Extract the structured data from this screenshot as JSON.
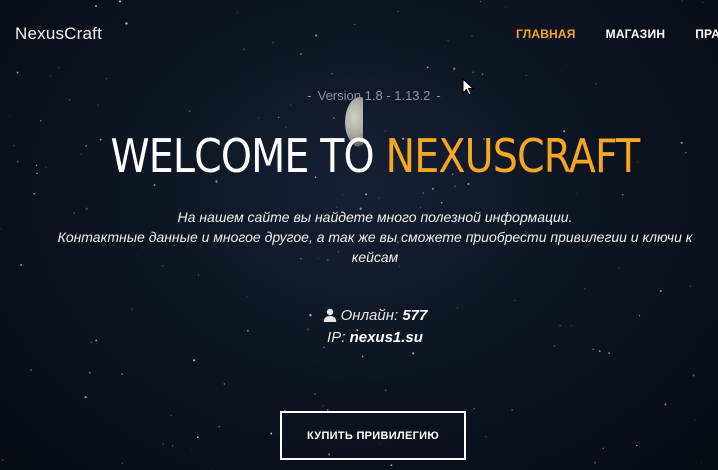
{
  "brand": "NexusCraft",
  "nav": {
    "items": [
      {
        "label": "ГЛАВНАЯ",
        "active": true
      },
      {
        "label": "МАГАЗИН",
        "active": false
      },
      {
        "label": "ПРАВИ",
        "active": false
      }
    ]
  },
  "hero": {
    "version_dash": "-",
    "version": "Version 1.8 - 1.13.2",
    "title_prefix": "WELCOME TO",
    "title_accent": "NEXUSCRAFT",
    "description_line1": "На нашем сайте вы найдете много полезной информации.",
    "description_line2": "Контактные данные и многое другое, а так же вы сможете приобрести привилегии и ключи к",
    "description_line3": "кейсам",
    "online_label": "Онлайн:",
    "online_count": "577",
    "ip_label": "IP:",
    "ip_value": "nexus1.su",
    "cta": "КУПИТЬ ПРИВИЛЕГИЮ"
  },
  "icons": {
    "user": "user-icon",
    "cursor": "mouse-cursor-icon"
  },
  "colors": {
    "accent": "#f5a623",
    "background": "#0c131f",
    "text": "#ffffff",
    "muted": "#8d93a0"
  }
}
